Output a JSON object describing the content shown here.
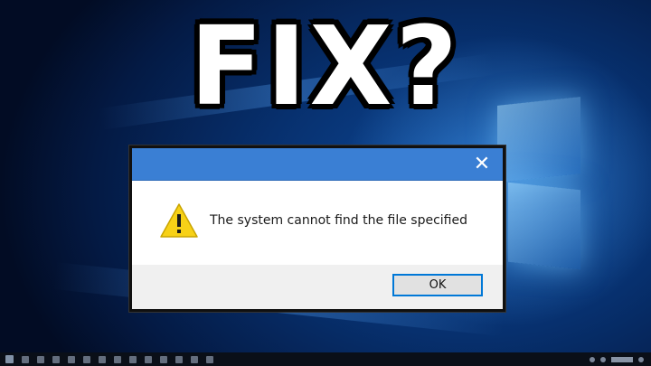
{
  "thumbnail": {
    "headline": "FIX?"
  },
  "dialog": {
    "close_glyph": "✕",
    "icon": "warning-icon",
    "message": "The system cannot find the file specified",
    "ok_label": "OK"
  },
  "desktop": {
    "wallpaper": "windows-10-hero",
    "accent": "#3a7fd4"
  },
  "taskbar": {
    "icons": [
      "start-icon",
      "search-icon",
      "task-view-icon",
      "app-icon",
      "app-icon",
      "app-icon",
      "app-icon",
      "app-icon",
      "app-icon",
      "app-icon",
      "app-icon",
      "app-icon",
      "app-icon",
      "app-icon"
    ]
  }
}
